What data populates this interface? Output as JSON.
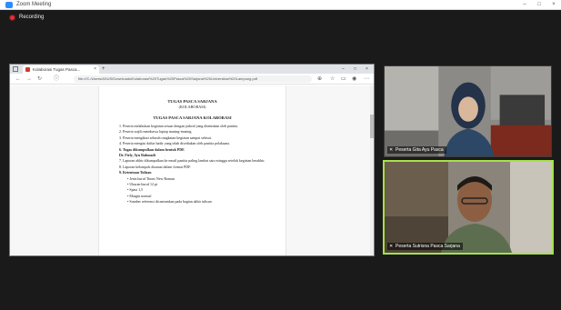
{
  "window": {
    "title": "Zoom Meeting",
    "minimize_icon": "minimize-icon",
    "maximize_icon": "maximize-icon",
    "close_icon": "close-icon"
  },
  "recording": {
    "label": "Recording",
    "color": "#e0303a"
  },
  "browser": {
    "tab_title": "Kolaborasi Tugas Pasca...",
    "new_tab": "+",
    "url": "file:///C:/Users/ASUS/Downloads/Kolaborasi%20Tugas%20Pasca%20Sarjana%20Universitas%20Lampung.pdf",
    "window_controls": [
      "–",
      "□",
      "×"
    ]
  },
  "document": {
    "heading": "TUGAS PASCA SARJANA",
    "subheading": "(KOLABORASI)",
    "section_title": "TUGAS PASCA SARJANA KOLABORASI",
    "items": [
      "1. Peserta melakukan kegiatan sesuai dengan jadwal yang ditentukan oleh panitia.",
      "2. Peserta wajib membawa laptop masing-masing.",
      "3. Peserta mengikuti seluruh rangkaian kegiatan sampai selesai.",
      "4. Peserta mengisi daftar hadir yang telah disediakan oleh panitia pelaksana.",
      "5. Peserta mengumpulkan tugas sesuai batas waktu yang ditentukan."
    ],
    "bold_item": "6. Tugas dikumpulkan dalam bentuk PDF.",
    "bold_item_2": "Dr. Firly, Ayu Rahmadi",
    "items_2": [
      "7. Laporan akhir dikumpulkan ke email panitia paling lambat satu minggu setelah kegiatan berakhir.",
      "8. Laporan kelompok disusun dalam format PDF."
    ],
    "criteria_title": "9. Ketentuan Tulisan",
    "sub_items": [
      "• Jenis huruf Times New Roman",
      "• Ukuran huruf 12 pt",
      "• Spasi 1,5",
      "• Margin normal",
      "• Sumber referensi dicantumkan pada bagian akhir tulisan"
    ]
  },
  "participants": [
    {
      "name": "Peserta Gita Ayu Pasca",
      "muted": true
    },
    {
      "name": "Peserta Sutrisna Pasca Sarjana",
      "muted": true
    }
  ],
  "accent_active_speaker": "#a8e04a"
}
